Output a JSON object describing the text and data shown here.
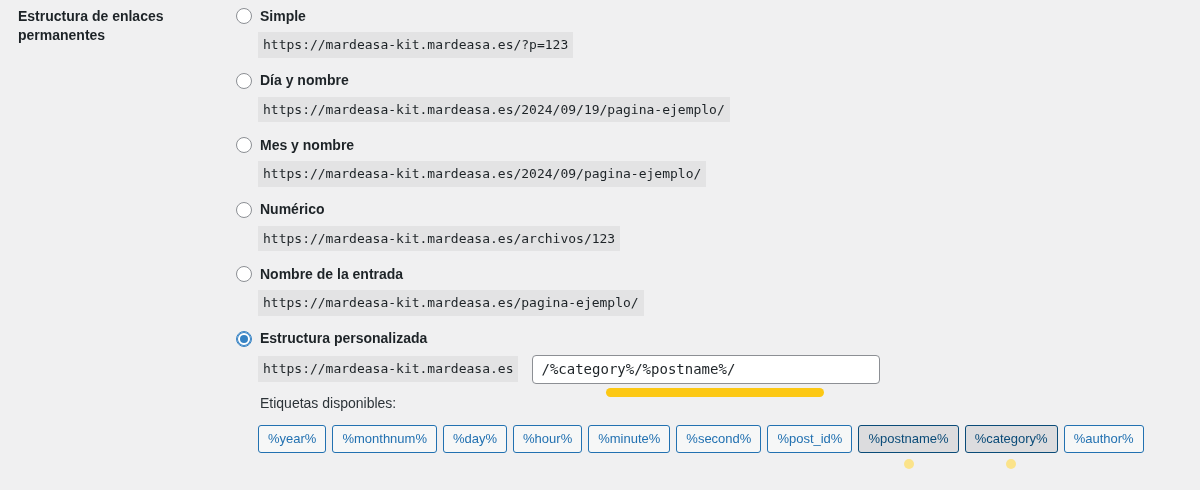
{
  "section_label": "Estructura de enlaces permanentes",
  "options": [
    {
      "label": "Simple",
      "selected": false,
      "example": "https://mardeasa-kit.mardeasa.es/?p=123"
    },
    {
      "label": "Día y nombre",
      "selected": false,
      "example": "https://mardeasa-kit.mardeasa.es/2024/09/19/pagina-ejemplo/"
    },
    {
      "label": "Mes y nombre",
      "selected": false,
      "example": "https://mardeasa-kit.mardeasa.es/2024/09/pagina-ejemplo/"
    },
    {
      "label": "Numérico",
      "selected": false,
      "example": "https://mardeasa-kit.mardeasa.es/archivos/123"
    },
    {
      "label": "Nombre de la entrada",
      "selected": false,
      "example": "https://mardeasa-kit.mardeasa.es/pagina-ejemplo/"
    }
  ],
  "custom": {
    "label": "Estructura personalizada",
    "selected": true,
    "prefix": "https://mardeasa-kit.mardeasa.es",
    "value": "/%category%/%postname%/",
    "highlighted": true,
    "tags_label": "Etiquetas disponibles:",
    "tags": [
      {
        "label": "%year%",
        "selected": false
      },
      {
        "label": "%monthnum%",
        "selected": false
      },
      {
        "label": "%day%",
        "selected": false
      },
      {
        "label": "%hour%",
        "selected": false
      },
      {
        "label": "%minute%",
        "selected": false
      },
      {
        "label": "%second%",
        "selected": false
      },
      {
        "label": "%post_id%",
        "selected": false
      },
      {
        "label": "%postname%",
        "selected": true
      },
      {
        "label": "%category%",
        "selected": true
      },
      {
        "label": "%author%",
        "selected": false
      }
    ]
  }
}
